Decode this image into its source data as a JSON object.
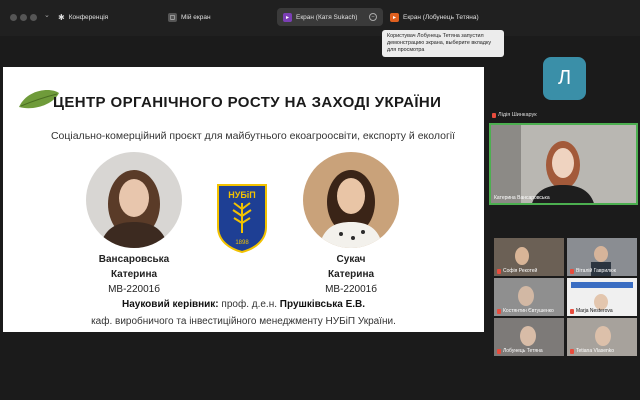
{
  "toolbar": {
    "conference_label": "Конференція",
    "my_screen_label": "Мій екран",
    "screen_tab_active": "Екран (Катя Sukach)",
    "screen_tab_other": "Екран (Лобунець Тетяна)"
  },
  "tooltip": {
    "text": "Користувач Лобунець Тетяна запустил демонстрацию экрана, выберите вкладку для просмотра"
  },
  "slide": {
    "title": "ЦЕНТР ОРГАНІЧНОГО РОСТУ НА ЗАХОДІ УКРАЇНИ",
    "subtitle": "Соціально-комерційний проєкт для майбутнього екоагроосвіти, експорту й екології",
    "person1": {
      "surname": "Вансаровська",
      "name": "Катерина",
      "group": "МВ-22001б"
    },
    "person2": {
      "surname": "Сукач",
      "name": "Катерина",
      "group": "МВ-22001б"
    },
    "logo_text": "НУБіП",
    "logo_year": "1898",
    "supervisor_label": "Науковий керівник:",
    "supervisor_value": "проф. д.е.н.",
    "supervisor_name": "Прушківська Е.В.",
    "department": "каф. виробничого та інвестиційного менеджменту НУБіП України."
  },
  "participants": {
    "top_avatar_letter": "Л",
    "top_avatar_name": "Лідія Шинкарук",
    "main_video_name": "Катерина Вансаровська",
    "grid": [
      {
        "name": "Софія Рекотей"
      },
      {
        "name": "Віталій Гаврилюк"
      },
      {
        "name": "Костянтин Євтушенко"
      },
      {
        "name": "Marja Nesterova"
      },
      {
        "name": "Лобунець Тетяна"
      },
      {
        "name": "Tetiana Vlasenko"
      }
    ]
  },
  "colors": {
    "accent_green": "#2e7d32",
    "mic_muted": "#e84c3d",
    "avatar_bg": "#3a8fa8",
    "logo_blue": "#1e3f94",
    "logo_yellow": "#f2c200"
  }
}
